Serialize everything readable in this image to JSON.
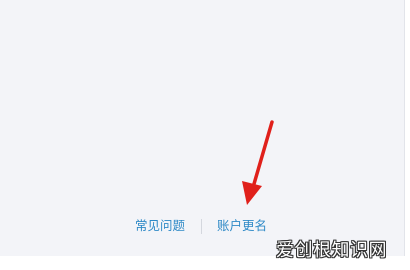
{
  "footer_links": {
    "faq_label": "常见问题",
    "rename_label": "账户更名"
  },
  "watermark": {
    "text": "爱创根知识网"
  },
  "colors": {
    "panel_background": "#f3f4f8",
    "link": "#2f8ac7",
    "arrow": "#e0201b"
  },
  "annotation": {
    "icon": "red-arrow-icon",
    "points_to": "账户更名"
  }
}
